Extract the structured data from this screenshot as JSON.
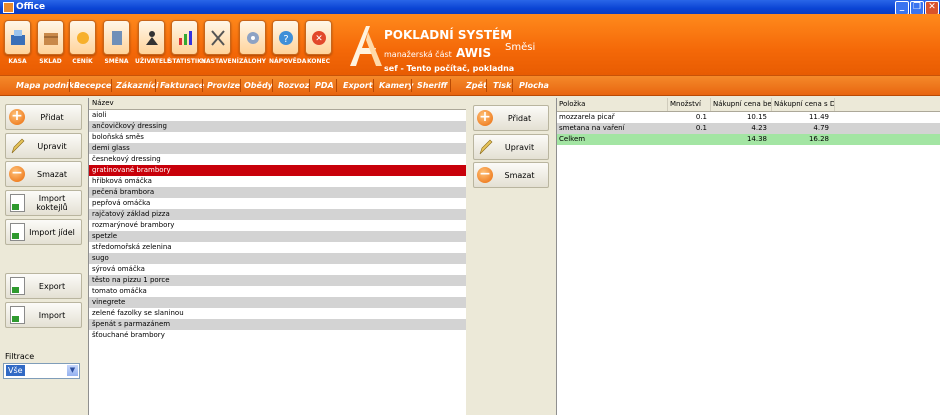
{
  "window": {
    "title": "Office"
  },
  "toolbar": [
    {
      "name": "kasa",
      "label": "KASA",
      "icon": "cash-register-icon"
    },
    {
      "name": "sklad",
      "label": "SKLAD",
      "icon": "warehouse-box-icon"
    },
    {
      "name": "cenik",
      "label": "CENÍK",
      "icon": "price-list-icon"
    },
    {
      "name": "smena",
      "label": "SMĚNA",
      "icon": "shift-icon"
    },
    {
      "name": "uzivatele",
      "label": "UŽIVATELÉ",
      "icon": "users-icon"
    },
    {
      "name": "statistiky",
      "label": "STATISTIKY",
      "icon": "chart-icon"
    },
    {
      "name": "nastaveni",
      "label": "NASTAVENÍ",
      "icon": "tools-icon"
    },
    {
      "name": "zalohy",
      "label": "ZÁLOHY",
      "icon": "backup-icon"
    },
    {
      "name": "napoveda",
      "label": "NÁPOVĚDA",
      "icon": "help-icon"
    },
    {
      "name": "konec",
      "label": "KONEC",
      "icon": "exit-icon"
    }
  ],
  "brand": {
    "title": "POKLADNÍ SYSTÉM",
    "subtitle": "manažerská část",
    "product": "AWIS",
    "section": "Směsi",
    "user_line": "sef  -  Tento počítač, pokladna"
  },
  "menu": [
    "Mapa podniku",
    "Recepce",
    "Zákazníci",
    "Fakturace",
    "Provize",
    "Obědy",
    "Rozvoz",
    "PDA",
    "Export",
    "Kamery",
    "Sheriff",
    "Zpět",
    "Tisk",
    "Plocha"
  ],
  "left_buttons": {
    "add": "Přidat",
    "edit": "Upravit",
    "delete": "Smazat",
    "import_cocktails": "Import koktejlů",
    "import_meals": "Import jídel",
    "export": "Export",
    "import": "Import"
  },
  "filter": {
    "label": "Filtrace",
    "value": "Vše"
  },
  "list": {
    "header": "Název",
    "selected_index": 5,
    "items": [
      "aioli",
      "ančovičkový dressing",
      "boloňská směs",
      "demi glass",
      "česnekový dressing",
      "gratinované brambory",
      "hříbková omáčka",
      "pečená brambora",
      "pepřová omáčka",
      "rajčatový základ pizza",
      "rozmarýnové brambory",
      "spetzle",
      "středomořská zelenina",
      "sugo",
      "sýrová omáčka",
      "těsto na pizzu 1 porce",
      "tomato omáčka",
      "vinegrete",
      "zelené fazolky se slaninou",
      "špenát s parmazánem",
      "šťouchané brambory"
    ]
  },
  "mid_buttons": {
    "add": "Přidat",
    "edit": "Upravit",
    "delete": "Smazat"
  },
  "components": {
    "headers": [
      "Položka",
      "Množství",
      "Nákupní cena be...",
      "Nákupní cena s DPH"
    ],
    "rows": [
      [
        "mozzarela picař",
        "0.1",
        "10.15",
        "11.49"
      ],
      [
        "smetana na vaření",
        "0.1",
        "4.23",
        "4.79"
      ]
    ],
    "total": [
      "Celkem",
      "",
      "14.38",
      "16.28"
    ]
  },
  "colors": {
    "accent": "#f46808",
    "selected": "#c8000a",
    "total_row": "#a3e5a3"
  }
}
